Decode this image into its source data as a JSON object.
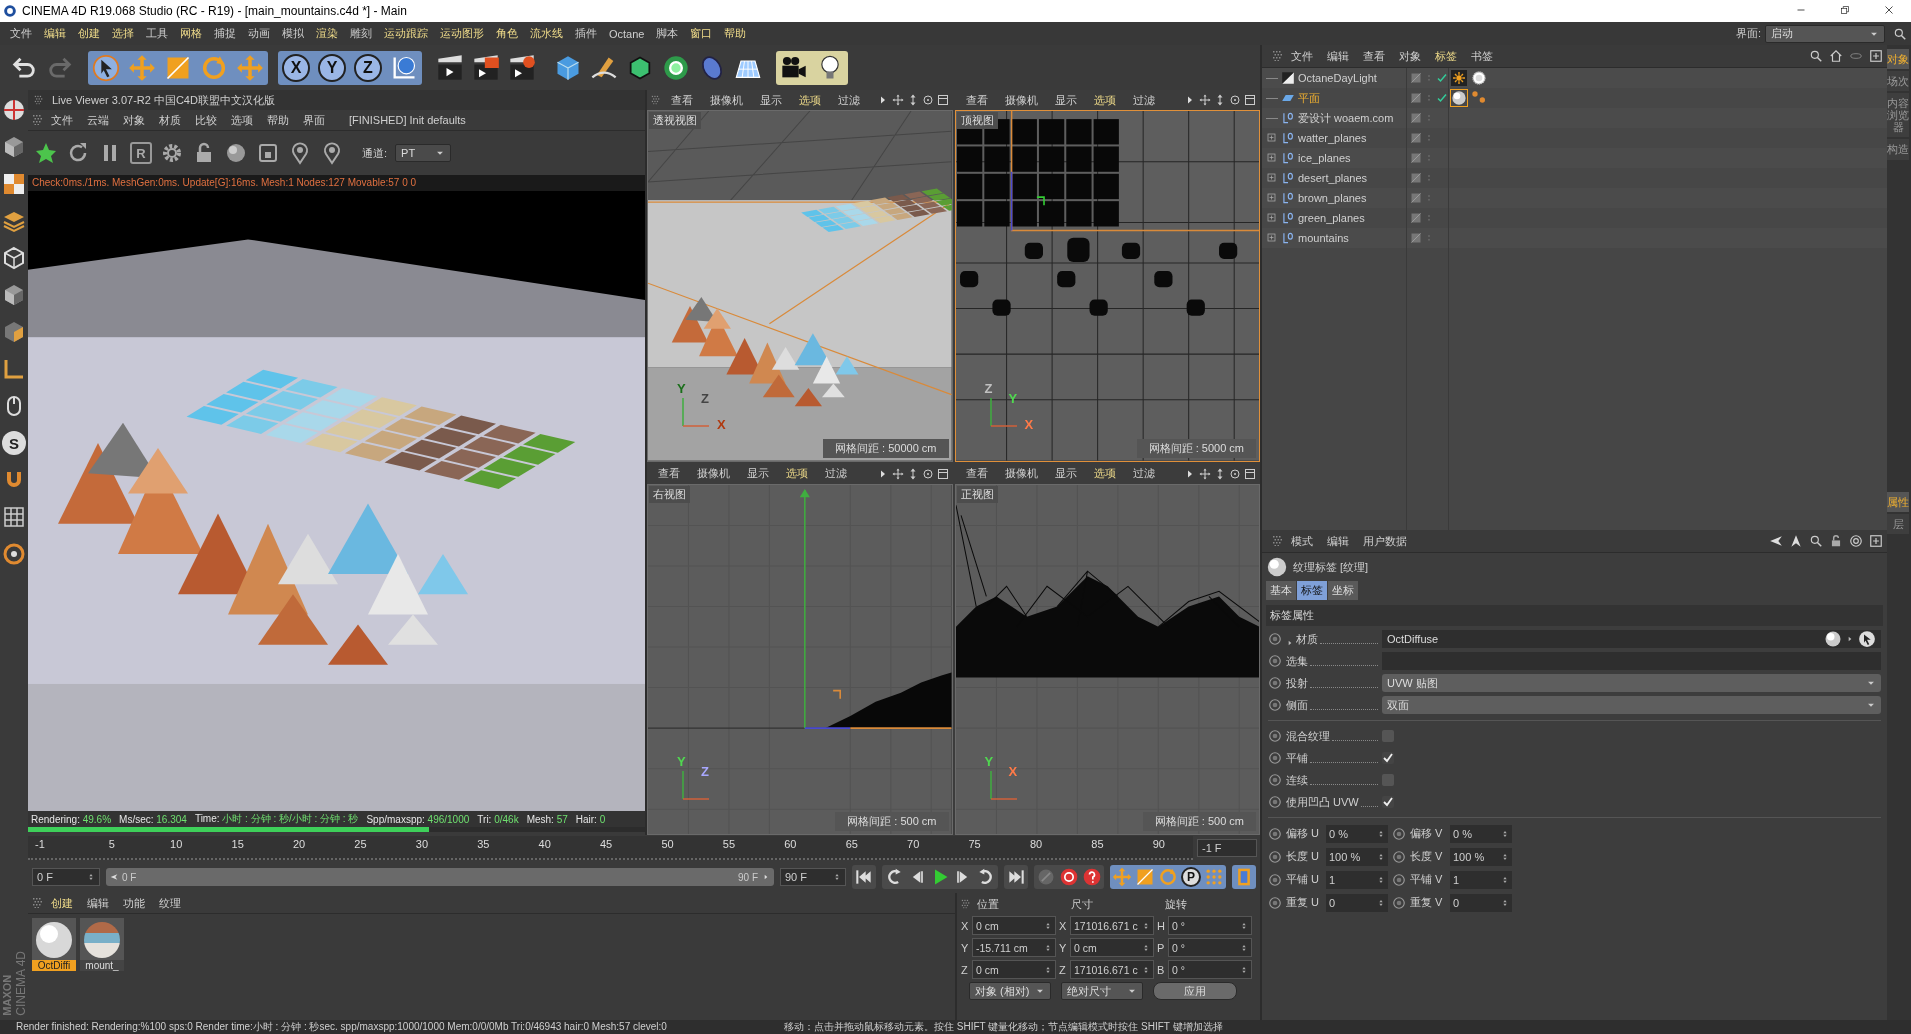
{
  "window": {
    "title": "CINEMA 4D R19.068 Studio (RC - R19) - [main_mountains.c4d *] - Main"
  },
  "menu_bar": {
    "items": [
      {
        "label": "文件",
        "highlighted": false
      },
      {
        "label": "编辑",
        "highlighted": true
      },
      {
        "label": "创建",
        "highlighted": true
      },
      {
        "label": "选择",
        "highlighted": true
      },
      {
        "label": "工具",
        "highlighted": false
      },
      {
        "label": "网格",
        "highlighted": true
      },
      {
        "label": "捕捉",
        "highlighted": false
      },
      {
        "label": "动画",
        "highlighted": false
      },
      {
        "label": "模拟",
        "highlighted": false
      },
      {
        "label": "渲染",
        "highlighted": true
      },
      {
        "label": "雕刻",
        "highlighted": false
      },
      {
        "label": "运动跟踪",
        "highlighted": true
      },
      {
        "label": "运动图形",
        "highlighted": true
      },
      {
        "label": "角色",
        "highlighted": true
      },
      {
        "label": "流水线",
        "highlighted": true
      },
      {
        "label": "插件",
        "highlighted": false
      },
      {
        "label": "Octane",
        "highlighted": false
      },
      {
        "label": "脚本",
        "highlighted": false
      },
      {
        "label": "窗口",
        "highlighted": true
      },
      {
        "label": "帮助",
        "highlighted": true
      }
    ],
    "layout_label": "界面:",
    "layout_value": "启动"
  },
  "toolbar": {
    "axis_buttons": [
      "X",
      "Y",
      "Z"
    ]
  },
  "left_toolbar": {
    "letter_button": "S"
  },
  "logo": {
    "brand": "MAXON",
    "product": "CINEMA 4D"
  },
  "live_viewer": {
    "title": "Live Viewer 3.07-R2 中国C4D联盟中文汉化版",
    "menu": [
      "文件",
      "云端",
      "对象",
      "材质",
      "比较",
      "选项",
      "帮助",
      "界面"
    ],
    "message": "[FINISHED] Init defaults",
    "render_button": "R",
    "channel_label": "通道:",
    "channel_value": "PT",
    "check_line": "Check:0ms./1ms. MeshGen:0ms. Update[G]:16ms. Mesh:1 Nodes:127 Movable:57  0 0",
    "stats": [
      {
        "label": "Rendering:",
        "value": "49.6%"
      },
      {
        "label": "Ms/sec:",
        "value": "16.304"
      },
      {
        "label": "Time:",
        "value": "小时 : 分钟 : 秒/小时 : 分钟 : 秒"
      },
      {
        "label": "Spp/maxspp:",
        "value": "496/1000"
      },
      {
        "label": "Tri:",
        "value": "0/46k"
      },
      {
        "label": "Mesh:",
        "value": "57"
      },
      {
        "label": "Hair:",
        "value": "0"
      }
    ],
    "progress": {
      "level": 0.65
    }
  },
  "viewports": [
    {
      "kind": "perspective",
      "label": "透视视图",
      "active": false,
      "grid_spacing": "网格间距 : 50000 cm",
      "menu": [
        {
          "label": "查看",
          "highlighted": false
        },
        {
          "label": "摄像机",
          "highlighted": false
        },
        {
          "label": "显示",
          "highlighted": false
        },
        {
          "label": "选项",
          "highlighted": true
        },
        {
          "label": "过滤",
          "highlighted": false
        }
      ],
      "axis_labels": [
        {
          "text": "Y",
          "color": "#1a6e1a"
        },
        {
          "text": "Z",
          "color": "#444444"
        },
        {
          "text": "X",
          "color": "#b03a10"
        }
      ]
    },
    {
      "kind": "top",
      "label": "顶视图",
      "active": true,
      "grid_spacing": "网格间距 : 5000 cm",
      "menu": [
        {
          "label": "查看",
          "highlighted": false
        },
        {
          "label": "摄像机",
          "highlighted": false
        },
        {
          "label": "显示",
          "highlighted": false
        },
        {
          "label": "选项",
          "highlighted": true
        },
        {
          "label": "过滤",
          "highlighted": false
        }
      ],
      "axis_labels": [
        {
          "text": "Z",
          "color": "#c0c0c0"
        },
        {
          "text": "Y",
          "color": "#50d850"
        },
        {
          "text": "X",
          "color": "#ff7a48"
        }
      ]
    },
    {
      "kind": "right",
      "label": "右视图",
      "active": false,
      "grid_spacing": "网格间距 : 500 cm",
      "menu": [
        {
          "label": "查看",
          "highlighted": false
        },
        {
          "label": "摄像机",
          "highlighted": false
        },
        {
          "label": "显示",
          "highlighted": false
        },
        {
          "label": "选项",
          "highlighted": true
        },
        {
          "label": "过滤",
          "highlighted": false
        }
      ],
      "axis_labels": [
        {
          "text": "Y",
          "color": "#50d850"
        },
        {
          "text": "Z",
          "color": "#a8a8ff"
        }
      ]
    },
    {
      "kind": "front",
      "label": "正视图",
      "active": false,
      "grid_spacing": "网格间距 : 500 cm",
      "menu": [
        {
          "label": "查看",
          "highlighted": false
        },
        {
          "label": "摄像机",
          "highlighted": false
        },
        {
          "label": "显示",
          "highlighted": false
        },
        {
          "label": "选项",
          "highlighted": true
        },
        {
          "label": "过滤",
          "highlighted": false
        }
      ],
      "axis_labels": [
        {
          "text": "Y",
          "color": "#50d850"
        },
        {
          "text": "X",
          "color": "#ff7a48"
        }
      ]
    }
  ],
  "timeline": {
    "ruler_labels": [
      "-1",
      "5",
      "10",
      "15",
      "20",
      "25",
      "30",
      "35",
      "40",
      "45",
      "50",
      "55",
      "60",
      "65",
      "70",
      "75",
      "80",
      "85",
      "90"
    ],
    "current_frame": "-1 F",
    "start_field": "0 F",
    "range_start": "0 F",
    "range_end": "90 F",
    "range": {
      "level": 1
    },
    "end_field": "90 F",
    "key_button": "P"
  },
  "materials": {
    "menu": [
      {
        "label": "创建",
        "highlighted": true
      },
      {
        "label": "编辑",
        "highlighted": false
      },
      {
        "label": "功能",
        "highlighted": false
      },
      {
        "label": "纹理",
        "highlighted": false
      }
    ],
    "items": [
      {
        "name": "OctDiffi",
        "kind": "white",
        "selected": true
      },
      {
        "name": "mount_",
        "kind": "striped",
        "selected": false
      }
    ]
  },
  "coordinates": {
    "headers": [
      "位置",
      "尺寸",
      "旋转"
    ],
    "rows": [
      {
        "cells": [
          {
            "axis": "X",
            "value": "0 cm"
          },
          {
            "axis": "X",
            "value": "171016.671 c"
          },
          {
            "axis": "H",
            "value": "0 °"
          }
        ]
      },
      {
        "cells": [
          {
            "axis": "Y",
            "value": "-15.711 cm"
          },
          {
            "axis": "Y",
            "value": "0 cm"
          },
          {
            "axis": "P",
            "value": "0 °"
          }
        ]
      },
      {
        "cells": [
          {
            "axis": "Z",
            "value": "0 cm"
          },
          {
            "axis": "Z",
            "value": "171016.671 c"
          },
          {
            "axis": "B",
            "value": "0 °"
          }
        ]
      }
    ],
    "dropdowns": [
      "对象 (相对)",
      "绝对尺寸"
    ],
    "apply": "应用"
  },
  "object_manager": {
    "menu": [
      {
        "label": "文件",
        "highlighted": false
      },
      {
        "label": "编辑",
        "highlighted": false
      },
      {
        "label": "查看",
        "highlighted": false
      },
      {
        "label": "对象",
        "highlighted": false
      },
      {
        "label": "标签",
        "highlighted": true
      },
      {
        "label": "书签",
        "highlighted": false
      }
    ],
    "objects": [
      {
        "name": "OctaneDayLight",
        "kind": "light",
        "expandable": false,
        "selected": false,
        "checked": true,
        "tags": [
          {
            "kind": "sun",
            "selected": false
          },
          {
            "kind": "sky",
            "selected": false
          }
        ]
      },
      {
        "name": "平面",
        "kind": "plane",
        "expandable": false,
        "selected": true,
        "checked": true,
        "tags": [
          {
            "kind": "material",
            "selected": true
          },
          {
            "kind": "dots",
            "selected": false
          }
        ]
      },
      {
        "name": "爱设计 woaem.com",
        "kind": "null",
        "expandable": false,
        "selected": false,
        "checked": false
      },
      {
        "name": "watter_planes",
        "kind": "null",
        "expandable": true,
        "selected": false,
        "checked": false
      },
      {
        "name": "ice_planes",
        "kind": "null",
        "expandable": true,
        "selected": false,
        "checked": false
      },
      {
        "name": "desert_planes",
        "kind": "null",
        "expandable": true,
        "selected": false,
        "checked": false
      },
      {
        "name": "brown_planes",
        "kind": "null",
        "expandable": true,
        "selected": false,
        "checked": false
      },
      {
        "name": "green_planes",
        "kind": "null",
        "expandable": true,
        "selected": false,
        "checked": false
      },
      {
        "name": "mountains",
        "kind": "null",
        "expandable": true,
        "selected": false,
        "checked": false
      }
    ]
  },
  "attributes": {
    "menu": [
      "模式",
      "编辑",
      "用户数据"
    ],
    "title": "纹理标签 [纹理]",
    "tabs": [
      {
        "label": "基本",
        "selected": false
      },
      {
        "label": "标签",
        "selected": true
      },
      {
        "label": "坐标",
        "selected": false
      }
    ],
    "section": "标签属性",
    "fields": [
      {
        "label": "材质",
        "kind": "link",
        "value": "OctDiffuse"
      },
      {
        "label": "选集",
        "kind": "text"
      },
      {
        "label": "投射",
        "kind": "dropdown",
        "value": "UVW 贴图"
      },
      {
        "label": "侧面",
        "kind": "dropdown",
        "value": "双面"
      }
    ],
    "checkboxes": [
      {
        "label": "混合纹理",
        "checked": false
      },
      {
        "label": "平铺",
        "checked": true
      },
      {
        "label": "连续",
        "checked": false
      },
      {
        "label": "使用凹凸 UVW",
        "checked": true
      }
    ],
    "pairs": [
      {
        "label_u": "偏移 U",
        "value_u": "0 %",
        "label_v": "偏移 V",
        "value_v": "0 %"
      },
      {
        "label_u": "长度 U",
        "value_u": "100 %",
        "label_v": "长度 V",
        "value_v": "100 %"
      },
      {
        "label_u": "平铺 U",
        "value_u": "1",
        "label_v": "平铺 V",
        "value_v": "1"
      },
      {
        "label_u": "重复 U",
        "value_u": "0",
        "label_v": "重复 V",
        "value_v": "0"
      }
    ]
  },
  "side_tabs": {
    "top": [
      {
        "label": "对象",
        "selected": true
      },
      {
        "label": "场次",
        "selected": false
      },
      {
        "label": "内容浏览器",
        "selected": false
      },
      {
        "label": "构造",
        "selected": false
      }
    ],
    "bottom": [
      {
        "label": "属性",
        "selected": true
      },
      {
        "label": "层",
        "selected": false
      }
    ]
  },
  "status_bar": {
    "left": "Render finished: Rendering:%100 sps:0 Render time:小时 : 分钟 : 秒sec. spp/maxspp:1000/1000 Mem:0/0/0Mb Tri:0/46943 hair:0 Mesh:57 clevel:0",
    "right": "移动：点击并拖动鼠标移动元素。按住 SHIFT 键量化移动；节点编辑模式时按住 SHIFT 键增加选择"
  }
}
